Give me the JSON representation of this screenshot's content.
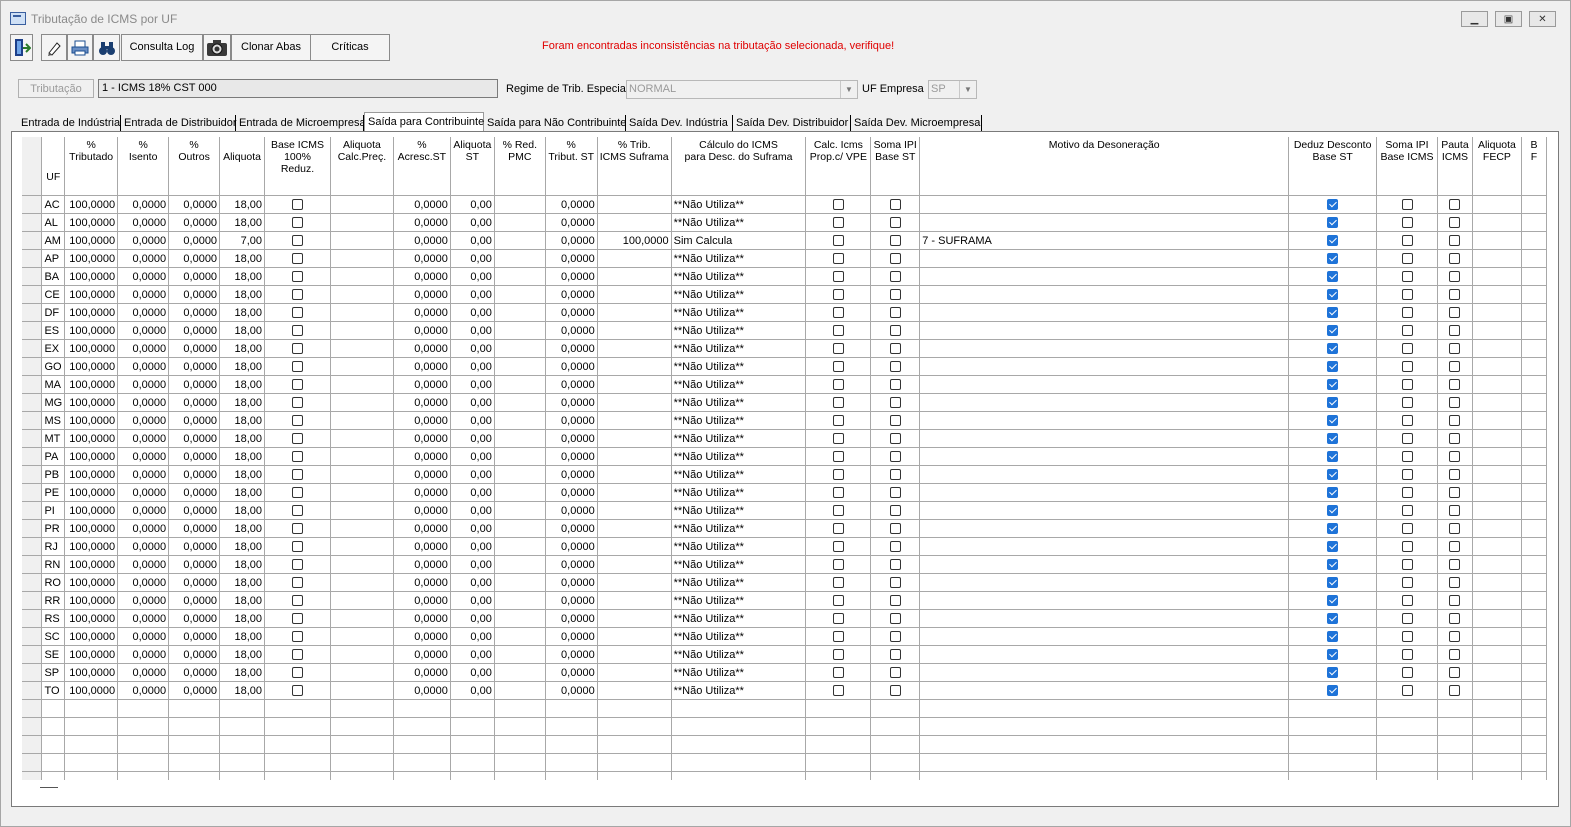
{
  "window": {
    "title": "Tributação de ICMS por UF",
    "controls": {
      "minimize": "▁",
      "maximize": "▣",
      "close": "✕"
    }
  },
  "toolbar": {
    "exit_icon": "exit-door-icon",
    "edit_icon": "pencil-icon",
    "print_icon": "printer-icon",
    "search_icon": "binoculars-icon",
    "log_label": "Consulta Log",
    "camera_icon": "camera-icon",
    "clone_label": "Clonar Abas",
    "critics_label": "Críticas"
  },
  "warning": "Foram encontradas inconsistências na tributação selecionada, verifique!",
  "form": {
    "trib_button": "Tributação",
    "trib_value": "1  - ICMS 18% CST 000",
    "regime_label": "Regime de Trib. Especial",
    "regime_value": "NORMAL",
    "uf_label": "UF Empresa",
    "uf_value": "SP"
  },
  "tabs": [
    "Entrada de Indústria",
    "Entrada de Distribuidor",
    "Entrada de Microempresa",
    "Saída para Contribuinte",
    "Saída para Não Contribuinte",
    "Saída Dev. Indústria",
    "Saída Dev. Distribuidor",
    "Saída Dev. Microempresa"
  ],
  "active_tab": 3,
  "columns": [
    "UF",
    "%\nTributado",
    "%\nIsento",
    "%\nOutros",
    "\nAliquota",
    "Base ICMS\n100% Reduz.",
    "Aliquota\nCalc.Preç.",
    "%\nAcresc.ST",
    "Aliquota\nST",
    "% Red.\nPMC",
    "%\nTribut. ST",
    "% Trib.\nICMS Suframa",
    "Cálculo do ICMS\npara Desc. do Suframa",
    "Calc. Icms\nProp.c/ VPE",
    "Soma IPI\nBase ST",
    "Motivo da Desoneração",
    "Deduz Desconto\nBase ST",
    "Soma IPI\nBase ICMS",
    "Pauta\nICMS",
    "Aliquota\nFECP",
    "B\nF"
  ],
  "rows": [
    {
      "uf": "AC",
      "trib": "100,0000",
      "isento": "0,0000",
      "outros": "0,0000",
      "aliq": "18,00",
      "acresc": "0,0000",
      "aliq_st": "0,00",
      "trib_st": "0,0000",
      "suframa": "",
      "calc": "**Não Utiliza**",
      "motivo": ""
    },
    {
      "uf": "AL",
      "trib": "100,0000",
      "isento": "0,0000",
      "outros": "0,0000",
      "aliq": "18,00",
      "acresc": "0,0000",
      "aliq_st": "0,00",
      "trib_st": "0,0000",
      "suframa": "",
      "calc": "**Não Utiliza**",
      "motivo": ""
    },
    {
      "uf": "AM",
      "trib": "100,0000",
      "isento": "0,0000",
      "outros": "0,0000",
      "aliq": "7,00",
      "acresc": "0,0000",
      "aliq_st": "0,00",
      "trib_st": "0,0000",
      "suframa": "100,0000",
      "calc": "Sim Calcula",
      "motivo": "7 - SUFRAMA"
    },
    {
      "uf": "AP",
      "trib": "100,0000",
      "isento": "0,0000",
      "outros": "0,0000",
      "aliq": "18,00",
      "acresc": "0,0000",
      "aliq_st": "0,00",
      "trib_st": "0,0000",
      "suframa": "",
      "calc": "**Não Utiliza**",
      "motivo": ""
    },
    {
      "uf": "BA",
      "trib": "100,0000",
      "isento": "0,0000",
      "outros": "0,0000",
      "aliq": "18,00",
      "acresc": "0,0000",
      "aliq_st": "0,00",
      "trib_st": "0,0000",
      "suframa": "",
      "calc": "**Não Utiliza**",
      "motivo": ""
    },
    {
      "uf": "CE",
      "trib": "100,0000",
      "isento": "0,0000",
      "outros": "0,0000",
      "aliq": "18,00",
      "acresc": "0,0000",
      "aliq_st": "0,00",
      "trib_st": "0,0000",
      "suframa": "",
      "calc": "**Não Utiliza**",
      "motivo": ""
    },
    {
      "uf": "DF",
      "trib": "100,0000",
      "isento": "0,0000",
      "outros": "0,0000",
      "aliq": "18,00",
      "acresc": "0,0000",
      "aliq_st": "0,00",
      "trib_st": "0,0000",
      "suframa": "",
      "calc": "**Não Utiliza**",
      "motivo": ""
    },
    {
      "uf": "ES",
      "trib": "100,0000",
      "isento": "0,0000",
      "outros": "0,0000",
      "aliq": "18,00",
      "acresc": "0,0000",
      "aliq_st": "0,00",
      "trib_st": "0,0000",
      "suframa": "",
      "calc": "**Não Utiliza**",
      "motivo": ""
    },
    {
      "uf": "EX",
      "trib": "100,0000",
      "isento": "0,0000",
      "outros": "0,0000",
      "aliq": "18,00",
      "acresc": "0,0000",
      "aliq_st": "0,00",
      "trib_st": "0,0000",
      "suframa": "",
      "calc": "**Não Utiliza**",
      "motivo": ""
    },
    {
      "uf": "GO",
      "trib": "100,0000",
      "isento": "0,0000",
      "outros": "0,0000",
      "aliq": "18,00",
      "acresc": "0,0000",
      "aliq_st": "0,00",
      "trib_st": "0,0000",
      "suframa": "",
      "calc": "**Não Utiliza**",
      "motivo": ""
    },
    {
      "uf": "MA",
      "trib": "100,0000",
      "isento": "0,0000",
      "outros": "0,0000",
      "aliq": "18,00",
      "acresc": "0,0000",
      "aliq_st": "0,00",
      "trib_st": "0,0000",
      "suframa": "",
      "calc": "**Não Utiliza**",
      "motivo": ""
    },
    {
      "uf": "MG",
      "trib": "100,0000",
      "isento": "0,0000",
      "outros": "0,0000",
      "aliq": "18,00",
      "acresc": "0,0000",
      "aliq_st": "0,00",
      "trib_st": "0,0000",
      "suframa": "",
      "calc": "**Não Utiliza**",
      "motivo": ""
    },
    {
      "uf": "MS",
      "trib": "100,0000",
      "isento": "0,0000",
      "outros": "0,0000",
      "aliq": "18,00",
      "acresc": "0,0000",
      "aliq_st": "0,00",
      "trib_st": "0,0000",
      "suframa": "",
      "calc": "**Não Utiliza**",
      "motivo": ""
    },
    {
      "uf": "MT",
      "trib": "100,0000",
      "isento": "0,0000",
      "outros": "0,0000",
      "aliq": "18,00",
      "acresc": "0,0000",
      "aliq_st": "0,00",
      "trib_st": "0,0000",
      "suframa": "",
      "calc": "**Não Utiliza**",
      "motivo": ""
    },
    {
      "uf": "PA",
      "trib": "100,0000",
      "isento": "0,0000",
      "outros": "0,0000",
      "aliq": "18,00",
      "acresc": "0,0000",
      "aliq_st": "0,00",
      "trib_st": "0,0000",
      "suframa": "",
      "calc": "**Não Utiliza**",
      "motivo": ""
    },
    {
      "uf": "PB",
      "trib": "100,0000",
      "isento": "0,0000",
      "outros": "0,0000",
      "aliq": "18,00",
      "acresc": "0,0000",
      "aliq_st": "0,00",
      "trib_st": "0,0000",
      "suframa": "",
      "calc": "**Não Utiliza**",
      "motivo": ""
    },
    {
      "uf": "PE",
      "trib": "100,0000",
      "isento": "0,0000",
      "outros": "0,0000",
      "aliq": "18,00",
      "acresc": "0,0000",
      "aliq_st": "0,00",
      "trib_st": "0,0000",
      "suframa": "",
      "calc": "**Não Utiliza**",
      "motivo": ""
    },
    {
      "uf": "PI",
      "trib": "100,0000",
      "isento": "0,0000",
      "outros": "0,0000",
      "aliq": "18,00",
      "acresc": "0,0000",
      "aliq_st": "0,00",
      "trib_st": "0,0000",
      "suframa": "",
      "calc": "**Não Utiliza**",
      "motivo": ""
    },
    {
      "uf": "PR",
      "trib": "100,0000",
      "isento": "0,0000",
      "outros": "0,0000",
      "aliq": "18,00",
      "acresc": "0,0000",
      "aliq_st": "0,00",
      "trib_st": "0,0000",
      "suframa": "",
      "calc": "**Não Utiliza**",
      "motivo": ""
    },
    {
      "uf": "RJ",
      "trib": "100,0000",
      "isento": "0,0000",
      "outros": "0,0000",
      "aliq": "18,00",
      "acresc": "0,0000",
      "aliq_st": "0,00",
      "trib_st": "0,0000",
      "suframa": "",
      "calc": "**Não Utiliza**",
      "motivo": ""
    },
    {
      "uf": "RN",
      "trib": "100,0000",
      "isento": "0,0000",
      "outros": "0,0000",
      "aliq": "18,00",
      "acresc": "0,0000",
      "aliq_st": "0,00",
      "trib_st": "0,0000",
      "suframa": "",
      "calc": "**Não Utiliza**",
      "motivo": ""
    },
    {
      "uf": "RO",
      "trib": "100,0000",
      "isento": "0,0000",
      "outros": "0,0000",
      "aliq": "18,00",
      "acresc": "0,0000",
      "aliq_st": "0,00",
      "trib_st": "0,0000",
      "suframa": "",
      "calc": "**Não Utiliza**",
      "motivo": ""
    },
    {
      "uf": "RR",
      "trib": "100,0000",
      "isento": "0,0000",
      "outros": "0,0000",
      "aliq": "18,00",
      "acresc": "0,0000",
      "aliq_st": "0,00",
      "trib_st": "0,0000",
      "suframa": "",
      "calc": "**Não Utiliza**",
      "motivo": ""
    },
    {
      "uf": "RS",
      "trib": "100,0000",
      "isento": "0,0000",
      "outros": "0,0000",
      "aliq": "18,00",
      "acresc": "0,0000",
      "aliq_st": "0,00",
      "trib_st": "0,0000",
      "suframa": "",
      "calc": "**Não Utiliza**",
      "motivo": ""
    },
    {
      "uf": "SC",
      "trib": "100,0000",
      "isento": "0,0000",
      "outros": "0,0000",
      "aliq": "18,00",
      "acresc": "0,0000",
      "aliq_st": "0,00",
      "trib_st": "0,0000",
      "suframa": "",
      "calc": "**Não Utiliza**",
      "motivo": ""
    },
    {
      "uf": "SE",
      "trib": "100,0000",
      "isento": "0,0000",
      "outros": "0,0000",
      "aliq": "18,00",
      "acresc": "0,0000",
      "aliq_st": "0,00",
      "trib_st": "0,0000",
      "suframa": "",
      "calc": "**Não Utiliza**",
      "motivo": ""
    },
    {
      "uf": "SP",
      "trib": "100,0000",
      "isento": "0,0000",
      "outros": "0,0000",
      "aliq": "18,00",
      "acresc": "0,0000",
      "aliq_st": "0,00",
      "trib_st": "0,0000",
      "suframa": "",
      "calc": "**Não Utiliza**",
      "motivo": ""
    },
    {
      "uf": "TO",
      "trib": "100,0000",
      "isento": "0,0000",
      "outros": "0,0000",
      "aliq": "18,00",
      "acresc": "0,0000",
      "aliq_st": "0,00",
      "trib_st": "0,0000",
      "suframa": "",
      "calc": "**Não Utiliza**",
      "motivo": ""
    }
  ],
  "colors": {
    "warning": "#e00000",
    "checked": "#1e73d8",
    "cell_text": "#000000"
  }
}
